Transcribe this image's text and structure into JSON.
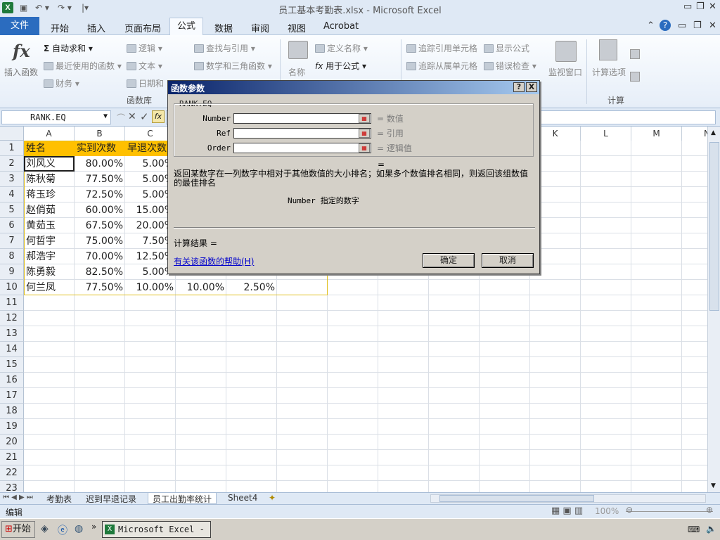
{
  "window": {
    "title": "员工基本考勤表.xlsx - Microsoft Excel",
    "logo": "X"
  },
  "tabs": {
    "file": "文件",
    "items": [
      "开始",
      "插入",
      "页面布局",
      "公式",
      "数据",
      "审阅",
      "视图",
      "Acrobat"
    ],
    "active": "公式"
  },
  "ribbon": {
    "insert_function": "插入函数",
    "autosum": "自动求和",
    "recent": "最近使用的函数",
    "finance": "财务",
    "logic": "逻辑",
    "text": "文本",
    "datetime": "日期和",
    "lookup": "查找与引用",
    "math": "数学和三角函数",
    "name_btn": "名称",
    "define_name": "定义名称",
    "use_in_formula": "用于公式",
    "trace_prec": "追踪引用单元格",
    "trace_dep": "追踪从属单元格",
    "show_formula": "显示公式",
    "error_check": "错误检查",
    "watch": "监视窗口",
    "calc_options": "计算选项",
    "group_library": "函数库",
    "group_calc": "计算"
  },
  "formula_bar": {
    "name_box": "RANK.EQ",
    "fx": "fx"
  },
  "columns": [
    "A",
    "B",
    "C",
    "D",
    "E",
    "F",
    "G",
    "H",
    "I",
    "J",
    "K",
    "L",
    "M",
    "N"
  ],
  "rows": [
    "1",
    "2",
    "3",
    "4",
    "5",
    "6",
    "7",
    "8",
    "9",
    "10",
    "11",
    "12",
    "13",
    "14",
    "15",
    "16",
    "17",
    "18",
    "19",
    "20",
    "21",
    "22",
    "23"
  ],
  "table": {
    "headers": [
      "姓名",
      "实到次数",
      "早退次数"
    ],
    "names": [
      "刘风义",
      "陈秋菊",
      "蒋玉珍",
      "赵俏茹",
      "黄茹玉",
      "何哲宇",
      "郝浩宇",
      "陈勇毅",
      "何兰凤"
    ],
    "col_b": [
      "80.00%",
      "77.50%",
      "72.50%",
      "60.00%",
      "67.50%",
      "75.00%",
      "70.00%",
      "82.50%",
      "77.50%"
    ],
    "col_c": [
      "5.00%",
      "5.00%",
      "5.00%",
      "15.00%",
      "20.00%",
      "7.50%",
      "12.50%",
      "5.00%",
      "10.00%"
    ],
    "row10_d": "10.00%",
    "row10_e": "2.50%"
  },
  "dialog": {
    "title": "函数参数",
    "help_btn": "?",
    "close_btn": "X",
    "func_name": "RANK.EQ",
    "args": [
      {
        "label": "Number",
        "hint": "= 数值"
      },
      {
        "label": "Ref",
        "hint": "= 引用"
      },
      {
        "label": "Order",
        "hint": "= 逻辑值"
      }
    ],
    "equals": "=",
    "description": "返回某数字在一列数字中相对于其他数值的大小排名；如果多个数值排名相同，则返回该组数值的最佳排名",
    "arg_name": "Number",
    "arg_desc": "指定的数字",
    "result_label": "计算结果 =",
    "help_link": "有关该函数的帮助(H)",
    "ok": "确定",
    "cancel": "取消"
  },
  "sheets": [
    "考勤表",
    "迟到早退记录",
    "员工出勤率统计",
    "Sheet4"
  ],
  "active_sheet": "员工出勤率统计",
  "status": {
    "mode": "编辑",
    "zoom": "100%"
  },
  "taskbar": {
    "start": "开始",
    "excel": "Microsoft Excel - ..."
  },
  "colors": {
    "header_fill": "#ffc000",
    "table_border": "#e0c020",
    "accent": "#2b6cbf"
  }
}
